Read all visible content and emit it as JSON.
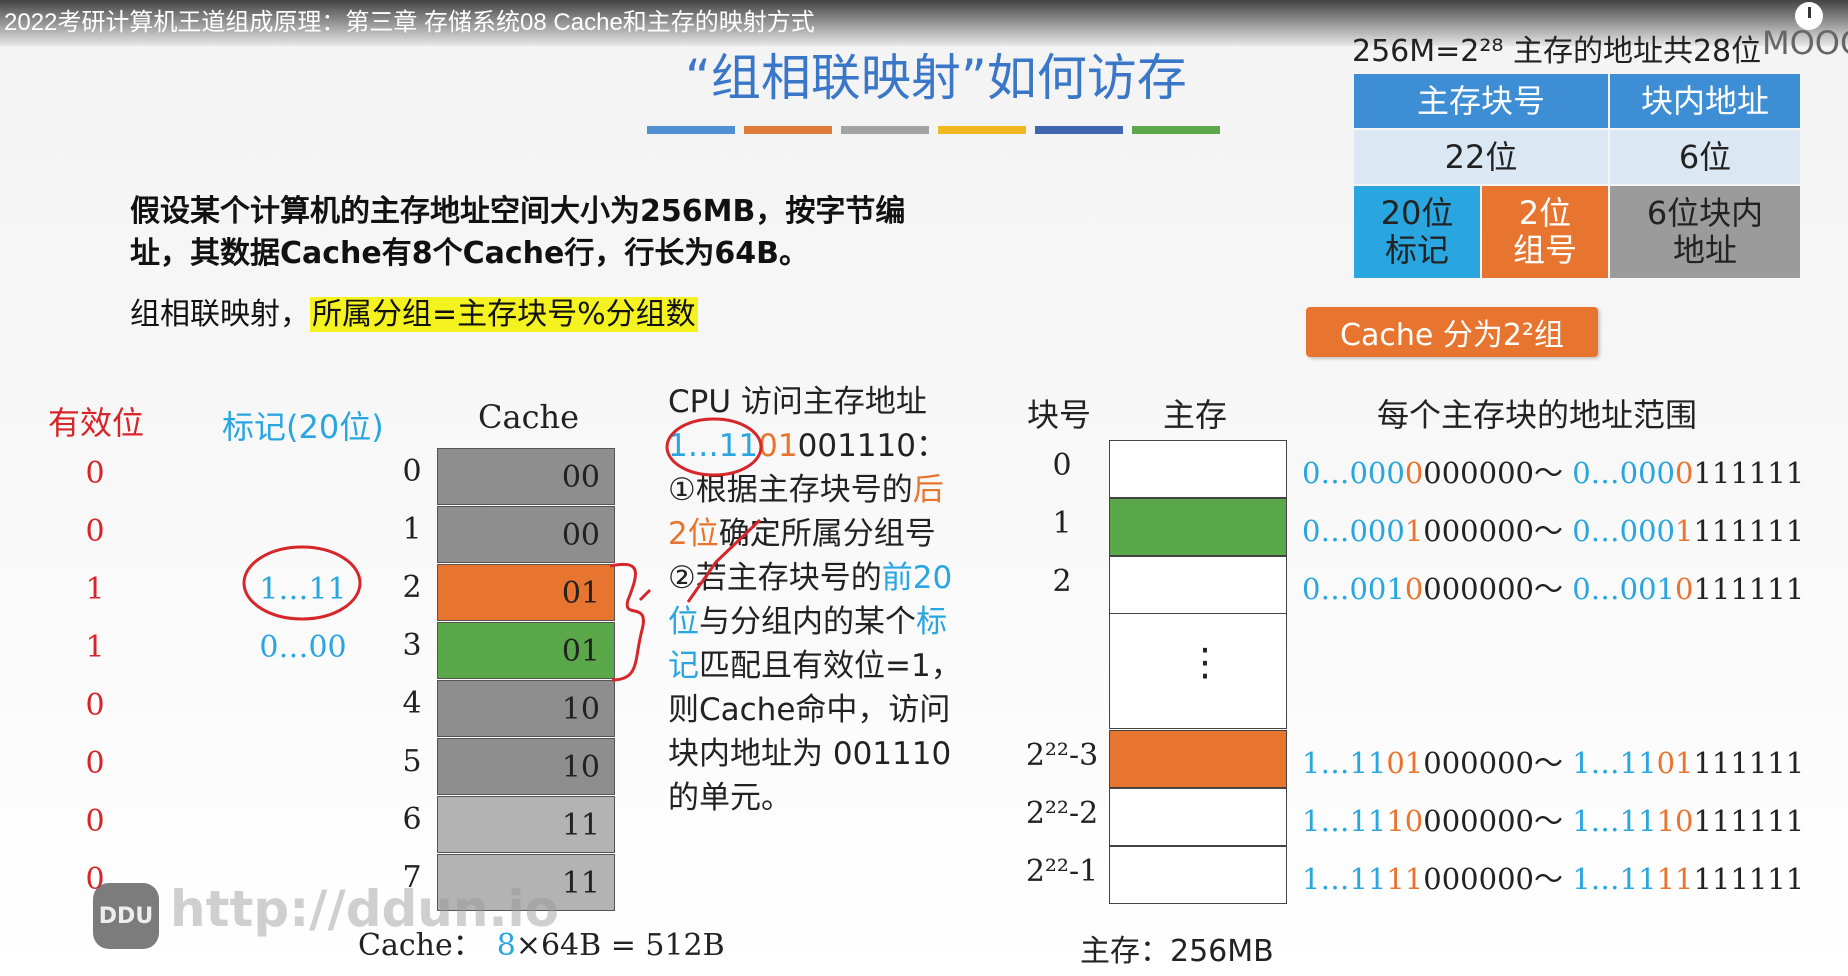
{
  "video": {
    "title": "2022考研计算机王道组成原理：第三章 存储系统08 Cache和主存的映射方式"
  },
  "slide": {
    "title": "“组相联映射”如何访存",
    "stripes": [
      "#4d8fd1",
      "#e07a3a",
      "#a3a3a3",
      "#f0b820",
      "#3f67b0",
      "#5aa84a"
    ],
    "para1_line1": "假设某个计算机的主存地址空间大小为256MB，按字节编",
    "para1_line2": "址，其数据Cache有8个Cache行，行长为64B。",
    "para2_prefix": "组相联映射，",
    "para2_highlight": "所属分组=主存块号%分组数"
  },
  "addr": {
    "caption": "256M=2²⁸ 主存的地址共28位",
    "caption_overlay": "MOOC",
    "h_block": "主存块号",
    "h_offset": "块内地址",
    "bits_block": "22位",
    "bits_offset": "6位",
    "tag_cell": "20位\n标记",
    "group_cell": "2位\n组号",
    "offset_cell": "6位块内\n地址",
    "groups_label": "Cache 分为2²组",
    "colors": {
      "header": "#3e8ed6",
      "light": "#dbe7f3",
      "tag": "#29a6e0",
      "group": "#e8752f",
      "offset": "#9b9b9b"
    }
  },
  "cache": {
    "valid_header": "有效位",
    "tag_header": "标记(20位)",
    "cache_header": "Cache",
    "valid_bits": [
      "0",
      "0",
      "1",
      "1",
      "0",
      "0",
      "0",
      "0"
    ],
    "tags": [
      "",
      "",
      "1…11",
      "0…00",
      "",
      "",
      "",
      ""
    ],
    "rows": [
      {
        "idx": "0",
        "value": "00",
        "color": "#8e8e8e"
      },
      {
        "idx": "1",
        "value": "00",
        "color": "#8e8e8e"
      },
      {
        "idx": "2",
        "value": "01",
        "color": "#e8752f"
      },
      {
        "idx": "3",
        "value": "01",
        "color": "#5aa84a"
      },
      {
        "idx": "4",
        "value": "10",
        "color": "#8e8e8e"
      },
      {
        "idx": "5",
        "value": "10",
        "color": "#8e8e8e"
      },
      {
        "idx": "6",
        "value": "11",
        "color": "#b3b3b3"
      },
      {
        "idx": "7",
        "value": "11",
        "color": "#b3b3b3"
      }
    ],
    "size_prefix": "Cache：",
    "size_count": "8",
    "size_suffix": "×64B = 512B"
  },
  "cpu": {
    "line1": "CPU 访问主存地址",
    "addr_tag": "1…11",
    "addr_group": "01",
    "addr_offset": "001110：",
    "step1_a": "①根据主存块号的",
    "step1_b": "后",
    "step1_c": "2位",
    "step1_d": "确定所属分组号",
    "step2_a": "②若主存块号的",
    "step2_b": "前20",
    "step2_c": "位",
    "step2_d": "与分组内的某个",
    "step2_e": "标",
    "step2_f": "记",
    "step2_g": "匹配且有效位=1，",
    "line_hit": "则Cache命中，访问",
    "line_addr": "块内地址为 001110",
    "line_unit": "的单元。"
  },
  "memory": {
    "h_blockno": "块号",
    "h_mem": "主存",
    "h_range": "每个主存块的地址范围",
    "dots": "⋮",
    "size_label": "主存：256MB",
    "blocks": [
      {
        "idx": "0",
        "color": "#ffffff",
        "r1a": "0…000",
        "r1b": "0",
        "r1c": "000000～ ",
        "r2a": "0…000",
        "r2b": "0",
        "r2c": "111111"
      },
      {
        "idx": "1",
        "color": "#5aa84a",
        "r1a": "0…000",
        "r1b": "1",
        "r1c": "000000～ ",
        "r2a": "0…000",
        "r2b": "1",
        "r2c": "111111"
      },
      {
        "idx": "2",
        "color": "#ffffff",
        "r1a": "0…001",
        "r1b": "0",
        "r1c": "000000～ ",
        "r2a": "0…001",
        "r2b": "0",
        "r2c": "111111"
      },
      {
        "idx": "2²²-3",
        "color": "#e8752f",
        "r1a": "1…11",
        "r1b": "01",
        "r1c": "000000～ ",
        "r2a": "1…11",
        "r2b": "01",
        "r2c": "111111"
      },
      {
        "idx": "2²²-2",
        "color": "#ffffff",
        "r1a": "1…11",
        "r1b": "10",
        "r1c": "000000～ ",
        "r2a": "1…11",
        "r2b": "10",
        "r2c": "111111"
      },
      {
        "idx": "2²²-1",
        "color": "#ffffff",
        "r1a": "1…11",
        "r1b": "11",
        "r1c": "000000～ ",
        "r2a": "1…11",
        "r2b": "11",
        "r2c": "111111"
      }
    ]
  },
  "watermark": {
    "logo": "DDU",
    "url": "http://ddun.io"
  }
}
